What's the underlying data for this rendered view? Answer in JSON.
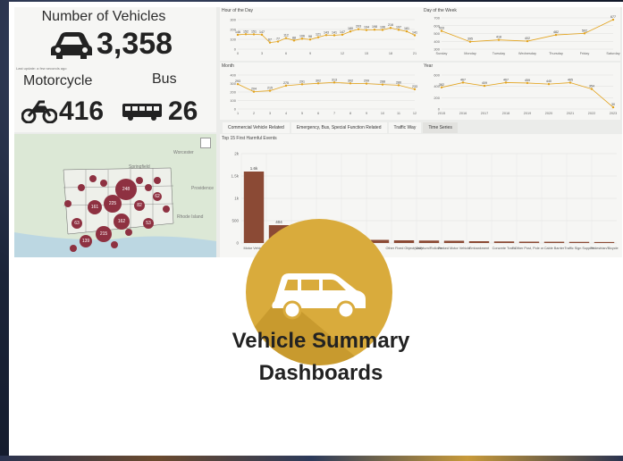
{
  "kpi": {
    "title": "Number of Vehicles",
    "total": "3,358",
    "motorcycle_label": "Motorcycle",
    "motorcycle_value": "416",
    "bus_label": "Bus",
    "bus_value": "26",
    "updated": "Last update: a few seconds ago"
  },
  "charts": {
    "hour": {
      "title": "Hour of the Day",
      "x": [
        "0",
        "3",
        "6",
        "9",
        "12",
        "15",
        "18",
        "21"
      ],
      "values": [
        146,
        152,
        151,
        147,
        67,
        77,
        112,
        88,
        106,
        98,
        121,
        143,
        141,
        147,
        180,
        203,
        194,
        198,
        196,
        216,
        197,
        181,
        141
      ],
      "yticks": [
        "0",
        "100",
        "200",
        "300"
      ],
      "ylim": [
        0,
        300
      ]
    },
    "day": {
      "title": "Day of the Week",
      "categories": [
        "Sunday",
        "Monday",
        "Tuesday",
        "Wednesday",
        "Thursday",
        "Friday",
        "Saturday"
      ],
      "values": [
        533,
        395,
        418,
        402,
        482,
        502,
        677
      ],
      "yticks": [
        "300",
        "400",
        "500",
        "600",
        "700"
      ],
      "ylim": [
        300,
        700
      ]
    },
    "month": {
      "title": "Month",
      "categories": [
        "1",
        "2",
        "3",
        "4",
        "5",
        "6",
        "7",
        "8",
        "9",
        "10",
        "11",
        "12"
      ],
      "values": [
        293,
        204,
        215,
        275,
        291,
        302,
        313,
        302,
        299,
        288,
        280,
        233
      ],
      "yticks": [
        "0",
        "100",
        "200",
        "300",
        "400"
      ],
      "ylim": [
        0,
        400
      ]
    },
    "year": {
      "title": "Year",
      "categories": [
        "2015",
        "2016",
        "2017",
        "2018",
        "2019",
        "2020",
        "2021",
        "2022",
        "2023"
      ],
      "values": [
        382,
        467,
        409,
        467,
        459,
        440,
        465,
        354,
        30
      ],
      "yticks": [
        "0",
        "200",
        "400",
        "600"
      ],
      "ylim": [
        0,
        600
      ]
    }
  },
  "tabs": [
    "Commercial Vehicle Related",
    "Emergency, Bus, Special Function Related",
    "Traffic Way",
    "Time Series"
  ],
  "harmful": {
    "title": "Top 15 First Harmful Events",
    "yticks": [
      "0",
      "500",
      "1k",
      "1.5k",
      "2k"
    ],
    "labels": [
      "Motor Vehicle",
      "",
      "",
      "",
      "",
      "",
      "Other Fixed Object(wall)",
      "Overturn/Rollover",
      "Parked Motor Vehicle",
      "Embankment",
      "Concrete Traffic",
      "Other Post, Pole or",
      "Cable Barrier",
      "Traffic Sign Support",
      "Pedestrian/Bicycle"
    ],
    "values": [
      1600,
      400,
      120,
      90,
      80,
      70,
      60,
      55,
      50,
      40,
      35,
      30,
      28,
      25,
      22
    ],
    "value_labels": [
      "1.6k",
      "404",
      "",
      "",
      "",
      "",
      "",
      "",
      "",
      "",
      "",
      "",
      "",
      "",
      ""
    ]
  },
  "map_labels": [
    "Springfield",
    "Worcester",
    "Providence",
    "Rhode Island"
  ],
  "map_values": [
    "248",
    "225",
    "161",
    "162",
    "215",
    "139",
    "63",
    "82",
    "53",
    "62"
  ],
  "app_title_line1": "Vehicle Summary",
  "app_title_line2": "Dashboards",
  "colors": {
    "accent": "#d9ab3c",
    "bar": "#8b4a35",
    "line": "#e2a21b",
    "map_dot": "#8e3141"
  }
}
